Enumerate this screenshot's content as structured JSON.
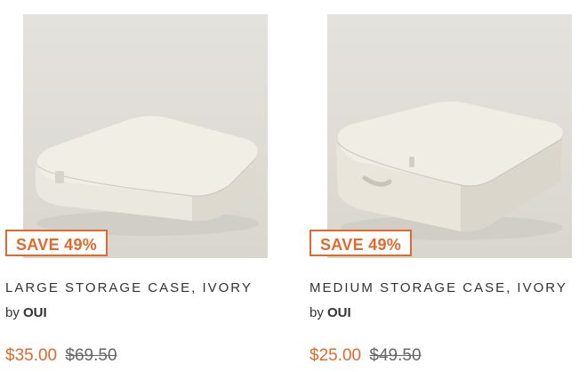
{
  "products": [
    {
      "badge": "SAVE 49%",
      "title": "LARGE STORAGE CASE, IVORY",
      "by_label": "by",
      "vendor": "OUI",
      "sale_price": "$35.00",
      "regular_price": "$69.50"
    },
    {
      "badge": "SAVE 49%",
      "title": "MEDIUM STORAGE CASE, IVORY",
      "by_label": "by",
      "vendor": "OUI",
      "sale_price": "$25.00",
      "regular_price": "$49.50"
    }
  ],
  "colors": {
    "accent": "#e06a2c",
    "text": "#333333",
    "photo_background": "#dcdad3"
  }
}
